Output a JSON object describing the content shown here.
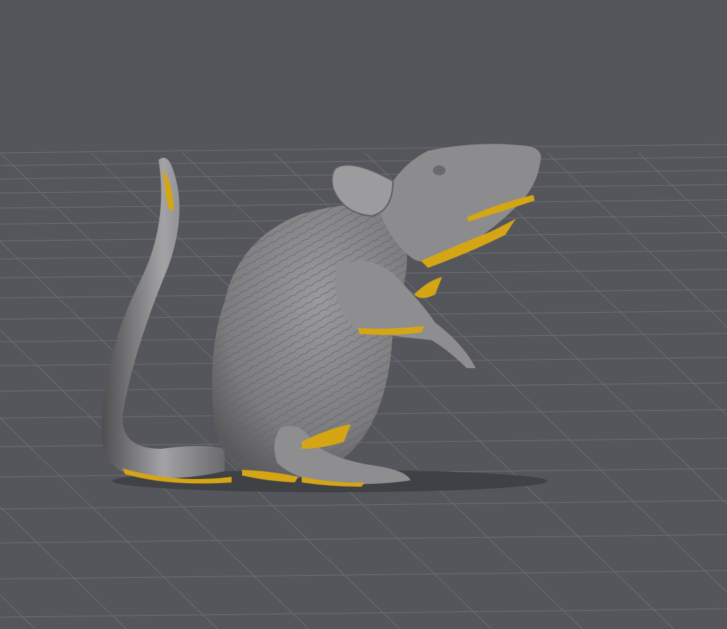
{
  "viewport": {
    "colors": {
      "background": "#55565b",
      "grid": "#6e6f74",
      "model": "#8c8c8e",
      "model_shade": "#5f5f62",
      "model_highlight": "#b4b4b6",
      "overhang": "#d4a514",
      "shadow": "#3e3f43"
    }
  }
}
